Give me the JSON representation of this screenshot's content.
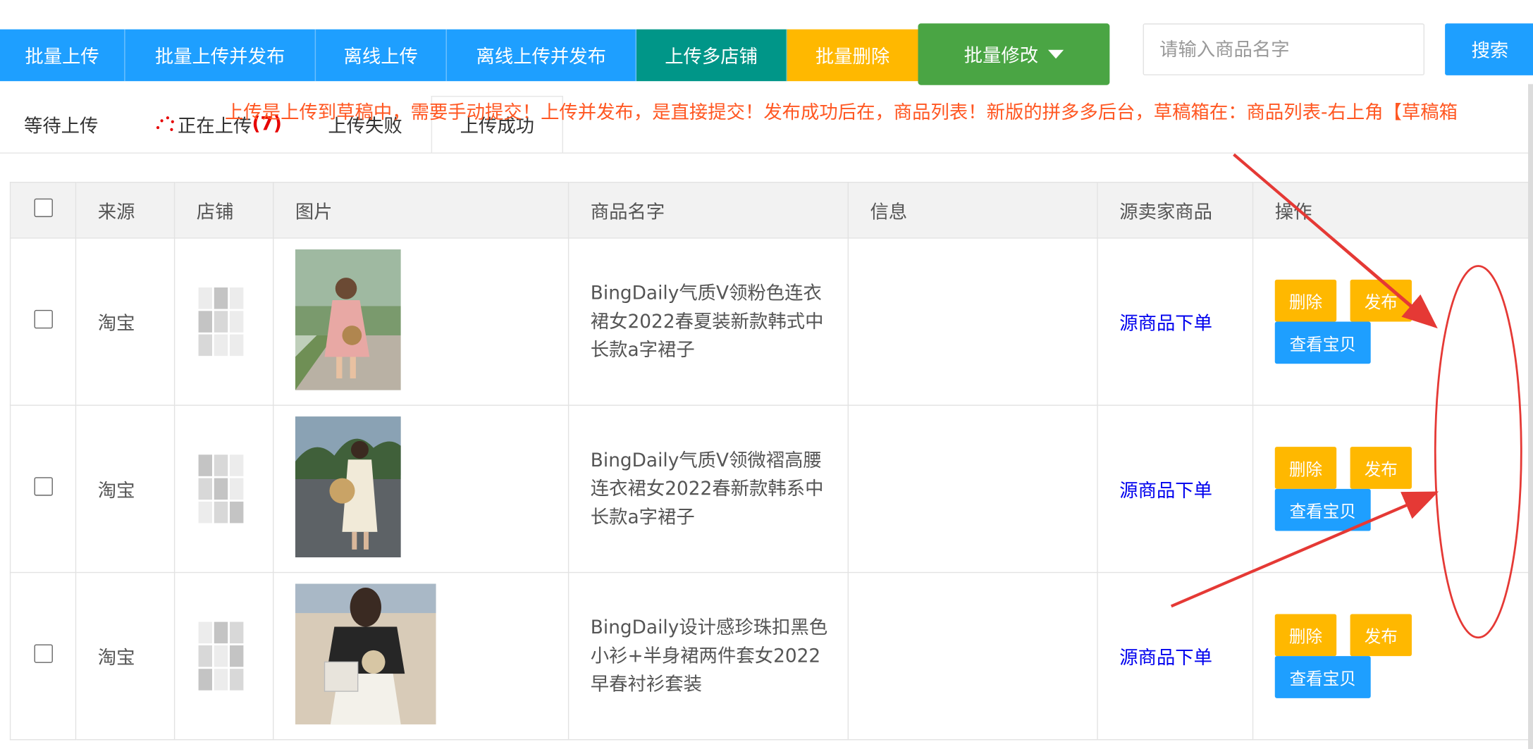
{
  "toolbar": {
    "buttons": [
      {
        "label": "批量上传"
      },
      {
        "label": "批量上传并发布"
      },
      {
        "label": "离线上传"
      },
      {
        "label": "离线上传并发布"
      },
      {
        "label": "上传多店铺"
      },
      {
        "label": "批量删除"
      },
      {
        "label": "批量修改"
      }
    ],
    "colors": {
      "primary": "#1e9fff",
      "teal": "#009688",
      "warn": "#ffb800",
      "green": "#4aa544"
    }
  },
  "search": {
    "placeholder": "请输入商品名字",
    "button_label": "搜索",
    "value": ""
  },
  "tabs": [
    {
      "label": "等待上传"
    },
    {
      "label": "正在上传",
      "count": "(7)"
    },
    {
      "label": "上传失败"
    },
    {
      "label": "上传成功"
    }
  ],
  "notice": "上传是上传到草稿中，需要手动提交！上传并发布，是直接提交！发布成功后在，商品列表！新版的拼多多后台，草稿箱在：商品列表-右上角【草稿箱",
  "table": {
    "columns": [
      "来源",
      "店铺",
      "图片",
      "商品名字",
      "信息",
      "源卖家商品",
      "操作"
    ],
    "rows": [
      {
        "source": "淘宝",
        "name": "BingDaily气质V领粉色连衣裙女2022春夏装新款韩式中长款a字裙子",
        "info": "",
        "seller_link": "源商品下单",
        "actions": [
          "删除",
          "发布",
          "查看宝贝"
        ]
      },
      {
        "source": "淘宝",
        "name": "BingDaily气质V领微褶高腰连衣裙女2022春新款韩系中长款a字裙子",
        "info": "",
        "seller_link": "源商品下单",
        "actions": [
          "删除",
          "发布",
          "查看宝贝"
        ]
      },
      {
        "source": "淘宝",
        "name": "BingDaily设计感珍珠扣黑色小衫+半身裙两件套女2022早春衬衫套装",
        "info": "",
        "seller_link": "源商品下单",
        "actions": [
          "删除",
          "发布",
          "查看宝贝"
        ]
      }
    ]
  },
  "annotation": {
    "color": "#e53935"
  }
}
